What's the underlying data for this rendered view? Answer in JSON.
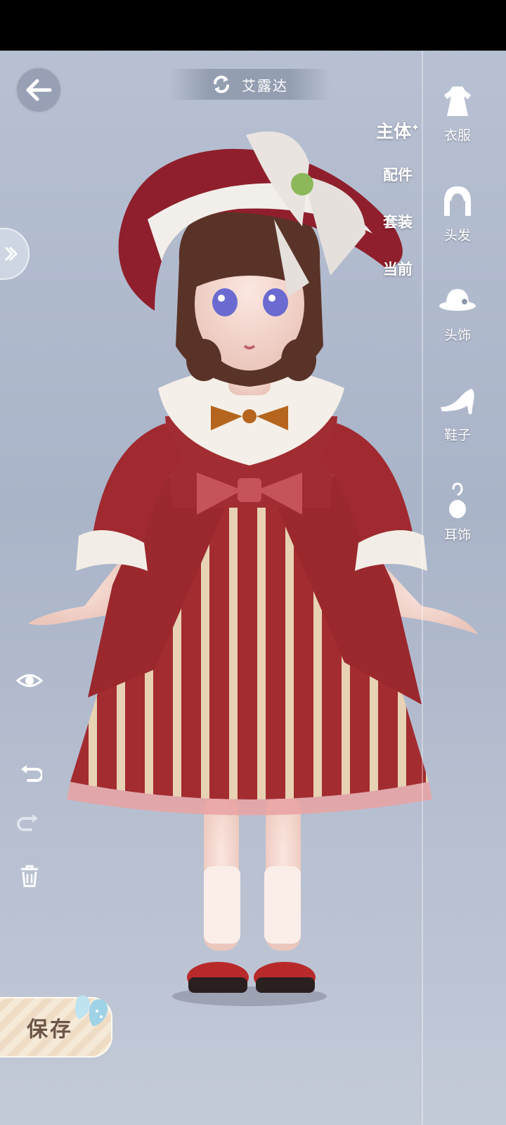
{
  "status_bar": {},
  "header": {
    "character_name": "艾露达",
    "back_icon": "arrow-left-icon",
    "switch_icon": "refresh-icon"
  },
  "sub_tabs": [
    {
      "label": "主体",
      "active": true
    },
    {
      "label": "配件",
      "active": false
    },
    {
      "label": "套装",
      "active": false
    },
    {
      "label": "当前",
      "active": false
    }
  ],
  "categories": [
    {
      "label": "衣服",
      "icon": "dress-icon"
    },
    {
      "label": "头发",
      "icon": "hair-icon"
    },
    {
      "label": "头饰",
      "icon": "hat-icon"
    },
    {
      "label": "鞋子",
      "icon": "shoe-icon"
    },
    {
      "label": "耳饰",
      "icon": "earring-icon"
    }
  ],
  "tools": {
    "eye_icon": "eye-icon",
    "undo_icon": "undo-icon",
    "redo_icon": "redo-icon",
    "delete_icon": "trash-icon"
  },
  "save": {
    "label": "保存"
  },
  "colors": {
    "dress_red": "#9e2a2e",
    "stripe_cream": "#e8d2b3",
    "lace_white": "#f3eee6",
    "bow_orange": "#b5651d"
  }
}
